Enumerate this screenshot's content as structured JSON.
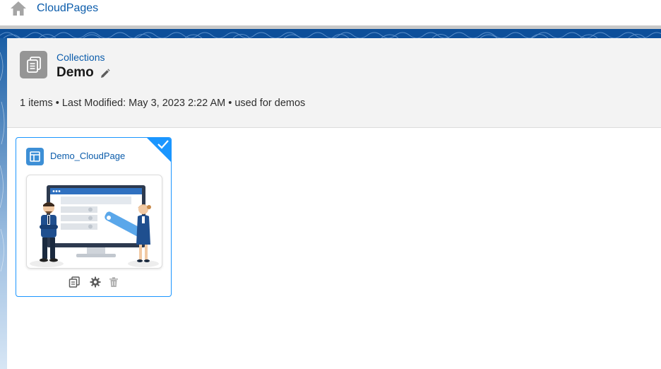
{
  "app": {
    "title": "CloudPages"
  },
  "header": {
    "breadcrumb": "Collections",
    "title": "Demo",
    "meta": "1 items • Last Modified: May 3, 2023 2:22 AM • used for demos"
  },
  "items": [
    {
      "title": "Demo_CloudPage",
      "selected": true
    }
  ],
  "colors": {
    "brand_blue": "#0b5cab",
    "accent": "#1b96ff",
    "band": "#0d4f9a"
  },
  "icons": [
    "home-icon",
    "collection-icon",
    "pencil-icon",
    "cloudpage-icon",
    "check-icon",
    "copy-icon",
    "gear-icon",
    "trash-icon"
  ]
}
